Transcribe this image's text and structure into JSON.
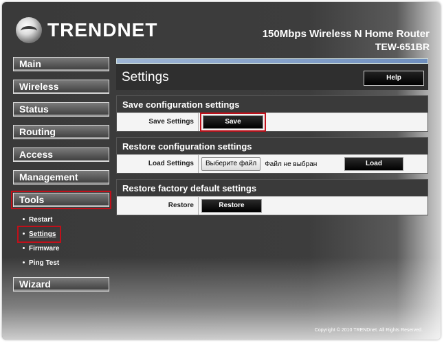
{
  "brand": {
    "logo_text": "TRENDNET",
    "model_line1": "150Mbps Wireless N Home Router",
    "model_line2": "TEW-651BR"
  },
  "nav": {
    "items": [
      {
        "id": "main",
        "label": "Main"
      },
      {
        "id": "wireless",
        "label": "Wireless"
      },
      {
        "id": "status",
        "label": "Status"
      },
      {
        "id": "routing",
        "label": "Routing"
      },
      {
        "id": "access",
        "label": "Access"
      },
      {
        "id": "management",
        "label": "Management"
      },
      {
        "id": "tools",
        "label": "Tools",
        "active": true
      }
    ],
    "tools_sub": [
      "Restart",
      "Settings",
      "Firmware",
      "Ping Test"
    ],
    "wizard": "Wizard"
  },
  "page": {
    "title": "Settings",
    "help": "Help",
    "sections": [
      {
        "title": "Save configuration settings",
        "row_label": "Save Settings",
        "button": "Save"
      },
      {
        "title": "Restore configuration settings",
        "row_label": "Load Settings",
        "file_button": "Выберите файл",
        "file_status": "Файл не выбран",
        "button": "Load"
      },
      {
        "title": "Restore factory default settings",
        "row_label": "Restore",
        "button": "Restore"
      }
    ]
  },
  "footer": "Copyright © 2010 TRENDnet. All Rights Reserved.",
  "colors": {
    "highlight": "#c0101a",
    "background": "#3a3a3a",
    "accent_bar": "#6f8fbf"
  }
}
